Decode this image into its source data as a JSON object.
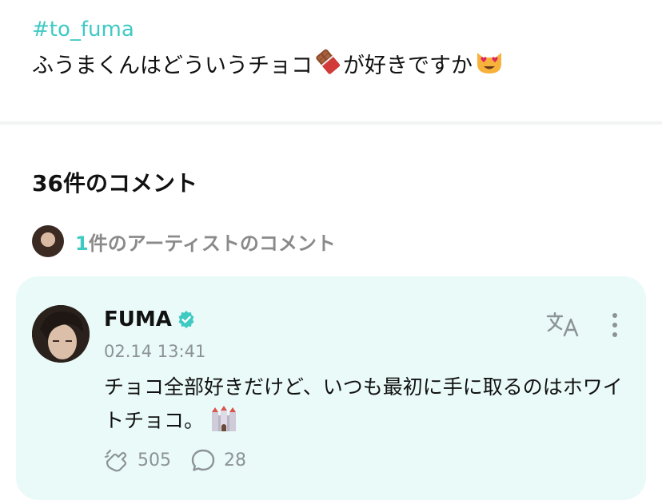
{
  "post": {
    "hashtag": "#to_fuma",
    "body_text": "ふうまくんはどういうチョコ",
    "body_emoji_1": "chocolate-bar",
    "body_text_2": "が好きですか",
    "body_emoji_2": "heart-eyes-cat"
  },
  "comments": {
    "title": "36件のコメント",
    "artist_count_number": "1",
    "artist_count_text": "件のアーティストのコメント"
  },
  "comment": {
    "author": "FUMA",
    "timestamp": "02.14 13:41",
    "text": "チョコ全部好きだけど、いつも最初に手に取るのはホワイトチョコ。",
    "trailing_emoji": "castle",
    "likes": "505",
    "replies": "28"
  },
  "colors": {
    "accent": "#3fc9c3",
    "card_background": "#e9faf8",
    "muted_text": "#8c9296"
  }
}
